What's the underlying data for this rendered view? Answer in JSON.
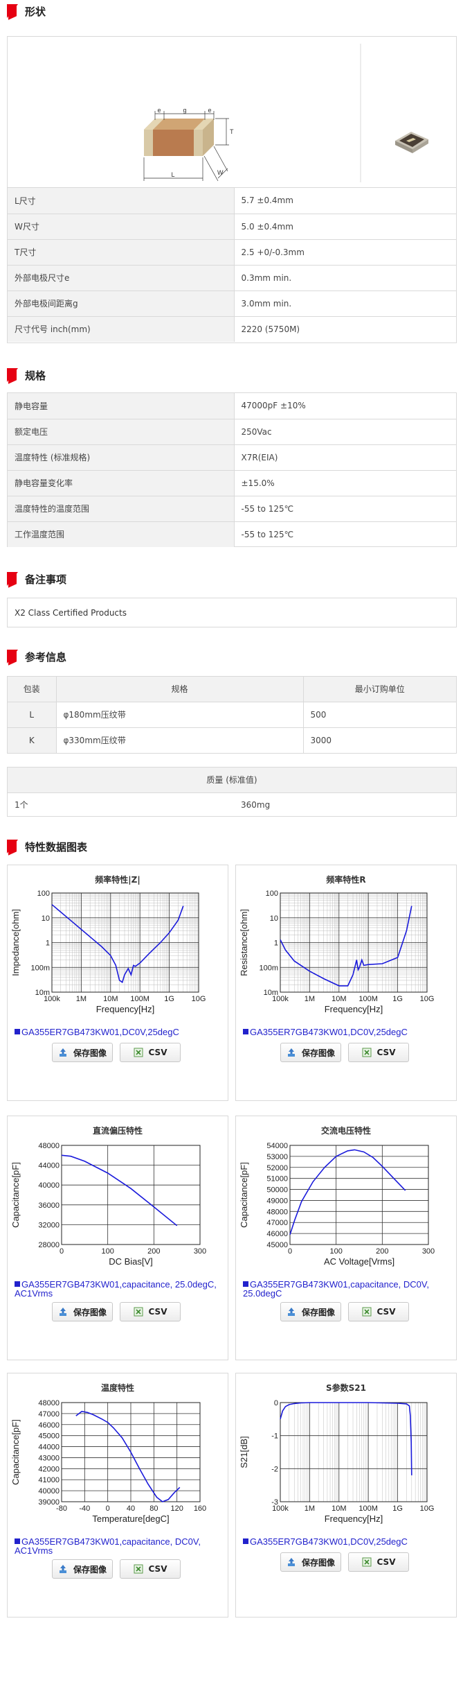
{
  "sections": {
    "shape": "形状",
    "spec": "规格",
    "remarks": "备注事项",
    "reference": "参考信息",
    "charts": "特性数据图表"
  },
  "diagram": {
    "e1": "e",
    "g": "g",
    "e2": "e",
    "T": "T",
    "L": "L",
    "W": "W"
  },
  "shape_rows": [
    {
      "label": "L尺寸",
      "value": "5.7 ±0.4mm"
    },
    {
      "label": "W尺寸",
      "value": "5.0 ±0.4mm"
    },
    {
      "label": "T尺寸",
      "value": "2.5 +0/-0.3mm"
    },
    {
      "label": "外部电极尺寸e",
      "value": "0.3mm min."
    },
    {
      "label": "外部电极间距离g",
      "value": "3.0mm min."
    },
    {
      "label": "尺寸代号 inch(mm)",
      "value": "2220 (5750M)"
    }
  ],
  "spec_rows": [
    {
      "label": "静电容量",
      "value": "47000pF ±10%"
    },
    {
      "label": "额定电压",
      "value": "250Vac"
    },
    {
      "label": "温度特性 (标准规格)",
      "value": "X7R(EIA)"
    },
    {
      "label": "静电容量变化率",
      "value": "±15.0%"
    },
    {
      "label": "温度特性的温度范围",
      "value": "-55 to 125℃"
    },
    {
      "label": "工作温度范围",
      "value": "-55 to 125℃"
    }
  ],
  "remarks_text": "X2 Class Certified Products",
  "packaging": {
    "headers": [
      "包装",
      "规格",
      "最小订购单位"
    ],
    "rows": [
      [
        "L",
        "φ180mm压纹带",
        "500"
      ],
      [
        "K",
        "φ330mm压纹带",
        "3000"
      ]
    ]
  },
  "mass": {
    "header": "质量 (标准值)",
    "label": "1个",
    "value": "360mg"
  },
  "buttons": {
    "save": "保存图像",
    "csv": "CSV"
  },
  "charts": [
    {
      "title": "频率特性|Z|",
      "legend": "GA355ER7GB473KW01,DC0V,25degC",
      "chart_data": {
        "type": "line",
        "xscale": "log",
        "yscale": "log",
        "xlabel": "Frequency[Hz]",
        "ylabel": "Impedance[ohm]",
        "xticks": [
          "100k",
          "1M",
          "10M",
          "100M",
          "1G",
          "10G"
        ],
        "yticks": [
          "100",
          "10",
          "1",
          "100m",
          "10m"
        ],
        "xlim": [
          100000,
          10000000000
        ],
        "ylim": [
          0.01,
          100
        ],
        "series": [
          {
            "color": "#1a1adb",
            "x": [
              100000,
              200000,
              500000,
              1000000,
              2000000,
              5000000,
              10000000,
              15000000,
              20000000,
              25000000,
              30000000,
              40000000,
              50000000,
              60000000,
              70000000,
              100000000,
              200000000,
              500000000,
              1000000000,
              2000000000,
              3000000000
            ],
            "y": [
              34,
              17,
              6.8,
              3.4,
              1.7,
              0.68,
              0.3,
              0.12,
              0.03,
              0.025,
              0.05,
              0.09,
              0.05,
              0.12,
              0.11,
              0.15,
              0.35,
              1.0,
              2.5,
              8,
              30
            ]
          }
        ]
      }
    },
    {
      "title": "频率特性R",
      "legend": "GA355ER7GB473KW01,DC0V,25degC",
      "chart_data": {
        "type": "line",
        "xscale": "log",
        "yscale": "log",
        "xlabel": "Frequency[Hz]",
        "ylabel": "Resistance[ohm]",
        "xticks": [
          "100k",
          "1M",
          "10M",
          "100M",
          "1G",
          "10G"
        ],
        "yticks": [
          "100",
          "10",
          "1",
          "100m",
          "10m"
        ],
        "xlim": [
          100000,
          10000000000
        ],
        "ylim": [
          0.01,
          100
        ],
        "series": [
          {
            "color": "#1a1adb",
            "x": [
              100000,
              150000,
              300000,
              1000000,
              3000000,
              10000000,
              20000000,
              30000000,
              40000000,
              45000000,
              50000000,
              60000000,
              70000000,
              100000000,
              300000000,
              1000000000,
              2000000000,
              3000000000
            ],
            "y": [
              1.3,
              0.5,
              0.18,
              0.07,
              0.035,
              0.018,
              0.018,
              0.05,
              0.2,
              0.08,
              0.1,
              0.2,
              0.12,
              0.13,
              0.14,
              0.25,
              3,
              30
            ]
          }
        ]
      }
    },
    {
      "title": "直流偏压特性",
      "legend": "GA355ER7GB473KW01,capacitance, 25.0degC, AC1Vrms",
      "chart_data": {
        "type": "line",
        "xlabel": "DC Bias[V]",
        "ylabel": "Capacitance[pF]",
        "xticks": [
          "0",
          "100",
          "200",
          "300"
        ],
        "yticks": [
          "48000",
          "44000",
          "40000",
          "36000",
          "32000",
          "28000"
        ],
        "xlim": [
          0,
          300
        ],
        "ylim": [
          28000,
          48000
        ],
        "series": [
          {
            "color": "#1a1adb",
            "x": [
              0,
              20,
              50,
              100,
              150,
              200,
              250
            ],
            "y": [
              46000,
              45800,
              44800,
              42400,
              39300,
              35600,
              31800
            ]
          }
        ]
      }
    },
    {
      "title": "交流电压特性",
      "legend": "GA355ER7GB473KW01,capacitance, DC0V, 25.0degC",
      "chart_data": {
        "type": "line",
        "xlabel": "AC Voltage[Vrms]",
        "ylabel": "Capacitance[pF]",
        "xticks": [
          "0",
          "100",
          "200",
          "300"
        ],
        "yticks": [
          "54000",
          "53000",
          "52000",
          "51000",
          "50000",
          "49000",
          "48000",
          "47000",
          "46000",
          "45000"
        ],
        "xlim": [
          0,
          300
        ],
        "ylim": [
          45000,
          54000
        ],
        "series": [
          {
            "color": "#1a1adb",
            "x": [
              0,
              10,
              25,
              50,
              75,
              100,
              125,
              140,
              160,
              180,
              200,
              225,
              250
            ],
            "y": [
              45900,
              47200,
              48900,
              50700,
              52000,
              53000,
              53500,
              53600,
              53400,
              52900,
              52100,
              51000,
              49900
            ]
          }
        ]
      }
    },
    {
      "title": "温度特性",
      "legend": "GA355ER7GB473KW01,capacitance, DC0V, AC1Vrms",
      "chart_data": {
        "type": "line",
        "xlabel": "Temperature[degC]",
        "ylabel": "Capacitance[pF]",
        "xticks": [
          "-80",
          "-40",
          "0",
          "40",
          "80",
          "120",
          "160"
        ],
        "yticks": [
          "48000",
          "47000",
          "46000",
          "45000",
          "44000",
          "43000",
          "42000",
          "41000",
          "40000",
          "39000"
        ],
        "xlim": [
          -80,
          160
        ],
        "ylim": [
          39000,
          48000
        ],
        "series": [
          {
            "color": "#1a1adb",
            "x": [
              -55,
              -45,
              -35,
              -25,
              -10,
              0,
              10,
              25,
              40,
              55,
              70,
              85,
              95,
              105,
              115,
              125
            ],
            "y": [
              46800,
              47200,
              47100,
              46900,
              46500,
              46200,
              45700,
              44800,
              43500,
              42000,
              40600,
              39400,
              39000,
              39200,
              39800,
              40300
            ]
          }
        ]
      }
    },
    {
      "title": "S参数S21",
      "legend": "GA355ER7GB473KW01,DC0V,25degC",
      "chart_data": {
        "type": "line",
        "xscale": "log",
        "xlabel": "Frequency[Hz]",
        "ylabel": "S21[dB]",
        "xticks": [
          "100k",
          "1M",
          "10M",
          "100M",
          "1G",
          "10G"
        ],
        "yticks": [
          "0",
          "-1",
          "-2",
          "-3"
        ],
        "xlim": [
          100000,
          10000000000
        ],
        "ylim": [
          -3,
          0
        ],
        "series": [
          {
            "color": "#1a1adb",
            "x": [
              100000,
              120000,
              150000,
              200000,
              300000,
              500000,
              1000000,
              100000000,
              1000000000,
              2000000000,
              2500000000,
              2700000000,
              2900000000,
              3000000000
            ],
            "y": [
              -0.5,
              -0.25,
              -0.12,
              -0.06,
              -0.03,
              -0.01,
              0,
              0,
              -0.02,
              -0.04,
              -0.1,
              -0.4,
              -1.2,
              -2.2
            ]
          }
        ]
      }
    }
  ]
}
